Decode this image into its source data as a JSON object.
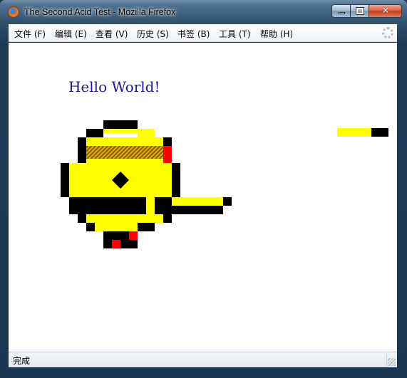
{
  "window": {
    "title": "The Second Acid Test - Mozilla Firefox",
    "buttons": [
      "minimize",
      "maximize",
      "close"
    ]
  },
  "menubar": {
    "items": [
      {
        "label": "文件 (F)"
      },
      {
        "label": "编辑 (E)"
      },
      {
        "label": "查看 (V)"
      },
      {
        "label": "历史 (S)"
      },
      {
        "label": "书签 (B)"
      },
      {
        "label": "工具 (T)"
      },
      {
        "label": "帮助 (H)"
      }
    ],
    "throbber_icon": "throbber-icon"
  },
  "page": {
    "heading": "Hello World!",
    "heading_color": "#1a1a8c",
    "colors": {
      "yellow": "#ffff00",
      "black": "#000000",
      "red": "#ff0000",
      "brown": "#b07a00"
    }
  },
  "statusbar": {
    "text": "完成"
  }
}
